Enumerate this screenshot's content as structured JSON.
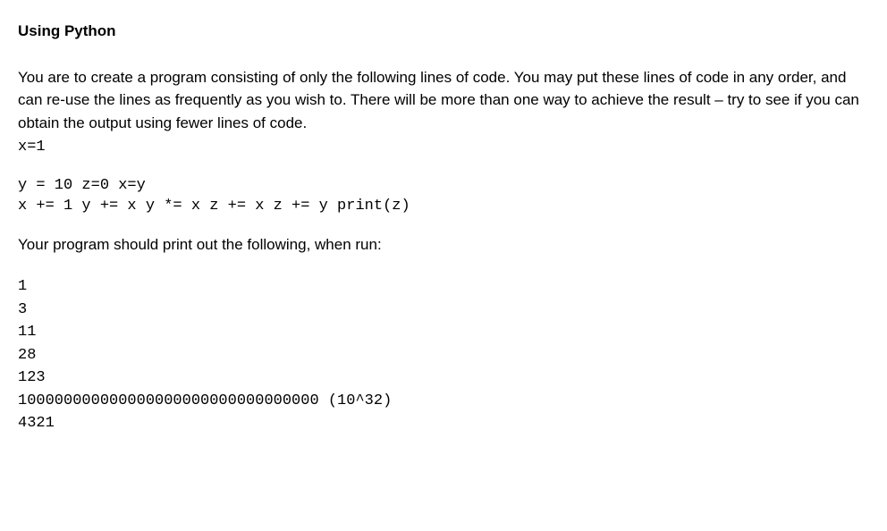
{
  "title": "Using Python",
  "paragraph": "You are to create a program consisting of only the following lines of code. You may put these lines of code in any order, and can re-use the lines as frequently as you wish to. There will be more than one way to achieve the result – try to see if you can obtain the output using fewer lines of code.",
  "code_line_1": "x=1",
  "code_line_2": "y = 10 z=0 x=y",
  "code_line_3": "x += 1 y += x y *= x z += x z += y print(z)",
  "instruction": "Your program should print out the following, when run:",
  "output": {
    "line1": "1",
    "line2": "3",
    "line3": "11",
    "line4": "28",
    "line5": "123",
    "line6": "100000000000000000000000000000000 (10^32)",
    "line7": "4321"
  }
}
